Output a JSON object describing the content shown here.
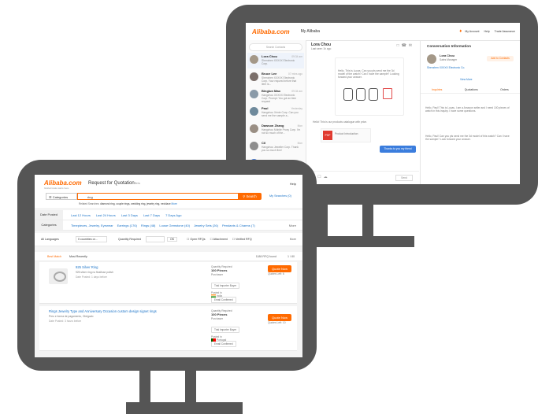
{
  "back": {
    "logo": "Alibaba.com",
    "page_title": "My Alibaba",
    "top_right": [
      "My Account",
      "Help",
      "Trade Assurance"
    ],
    "search_placeholder": "Search Contacts",
    "chat_contact": "Lora Chou",
    "chat_status": "Last seen 1h ago",
    "conversations": [
      {
        "name": "Lora Chou",
        "snippet": "Shenzhen XXXXX Electronic Corp.",
        "time": "09:34 am"
      },
      {
        "name": "Bruce Lee",
        "snippet": "Shenzhen XXXXX Electronic Corp. Your request before that item is...",
        "time": "07 mins ago"
      },
      {
        "name": "Bingiun Mao",
        "snippet": "Hangzhou XXXXX Electronic Corp. Prompt: You got an item request",
        "time": "09:34 am"
      },
      {
        "name": "Paul",
        "snippet": "Hangzhou Xrinte Corp. Can you send me the sample a...",
        "time": "Yesterday"
      },
      {
        "name": "Dawson Zhang",
        "snippet": "Hangzhou Mobile Proxy Corp. I'm not so much of the...",
        "time": "Mon"
      },
      {
        "name": "Cil",
        "snippet": "Hangzhou Jeweller Corp. Thank you so much fine!",
        "time": "Mon"
      },
      {
        "name": "New Contacts",
        "snippet": "",
        "time": ""
      }
    ],
    "chat_intro": "Hello, This is Lucas. Can you pls send me the 3d model of the watch? Can I have the sample? Looking forward your answer.",
    "product_label": "Product Introduction",
    "pdf_label": "PDF",
    "chat_line": "Hello! This is our products catalogue with price.",
    "reply_bubble": "Thanks to you my friend",
    "send_label": "Send",
    "info_title": "Conversation Information",
    "info_name": "Lora Chou",
    "info_role": "Sales Manager",
    "info_company": "Shenzhen XXXXX Electronic Co.",
    "add_contacts": "Add to Contacts",
    "view_more": "View More",
    "info_tabs": [
      "Inquiries",
      "Quotations",
      "Orders"
    ],
    "info_msgs": [
      "Hello, Paul! This is Lucas, I am a Amazon seller and I need 100 pieces of watch in this inquiry. I have some questions.",
      "Hello, Paul! Can you pls send me the 3d model of this watch? Can I have the sample? Look forward your answer."
    ]
  },
  "front": {
    "logo": "Alibaba.com",
    "logo_sub": "Global trade starts here",
    "page_title": "Request for Quotation",
    "page_title_suffix": "Beta",
    "help": "Help",
    "categories_select": "Categories",
    "search_value": "ring",
    "search_button": "Search",
    "my_searches": "My Searches (0)",
    "related_label": "Related Searches:",
    "related_searches": "diamond ring, couple rings, wedding ring, jewelry ring, necklace",
    "related_more": "More",
    "date_posted_label": "Date Posted",
    "date_options": [
      "Last 12 Hours",
      "Last 24 Hours",
      "Last 3 Days",
      "Last 7 Days",
      "7 Days Ago"
    ],
    "categories_label": "Categories",
    "category_options": [
      "Timepieces, Jewelry, Eyewear",
      "Earrings (176)",
      "Rings (48)",
      "Loose Gemstone (40)",
      "Jewelry Sets (26)",
      "Pendants & Charms (7)"
    ],
    "more": "More",
    "filter_language": "All Languages",
    "filter_countries": "0 countries or...",
    "filter_quantity": "Quantity Required",
    "filter_ok": "OK",
    "filter_open_rfq": "Open RFQs",
    "filter_attachment": "Attachment",
    "filter_verified": "Verified RFQ",
    "sort_best": "Best Match",
    "sort_recent": "Most Recently",
    "result_count": "1188 RFQ found",
    "pager": "1 / 80",
    "listings": [
      {
        "title": "925 Silver Ring",
        "desc": "925 silver ring no finalfuse polish",
        "posted": "Date Posted: 1 days before",
        "qty_label": "Quantity Required",
        "qty": "100 Pieces",
        "purchaser_label": "Purchaser",
        "chips": [
          "Trial Importer Buyer",
          "Email Confirmed"
        ],
        "posted_in_label": "Posted in",
        "country": "India",
        "flag": [
          "#ff9933",
          "#ffffff",
          "#138808"
        ],
        "quote_button": "Quote Now",
        "quotes_left": "Quotes Left: 6"
      },
      {
        "title": "Rings Jewelry Type and Anniversary Occasion custom design signet rings",
        "desc": "Preo e forma de pagamento, Obrigado",
        "posted": "Date Posted: 3 hours before",
        "qty_label": "Quantity Required",
        "qty": "100 Pieces",
        "purchaser_label": "Purchaser",
        "chips": [
          "Trial Importer Buyer",
          "Email Confirmed"
        ],
        "posted_in_label": "Posted in",
        "country": "Portugal",
        "flag": [
          "#006600",
          "#ff0000",
          "#ff0000"
        ],
        "quote_button": "Quote Now",
        "quotes_left": "Quotes Left: 10"
      }
    ]
  },
  "colors": {
    "frame": "#555555",
    "accent": "#ff6a00",
    "link": "#1a73c8"
  }
}
